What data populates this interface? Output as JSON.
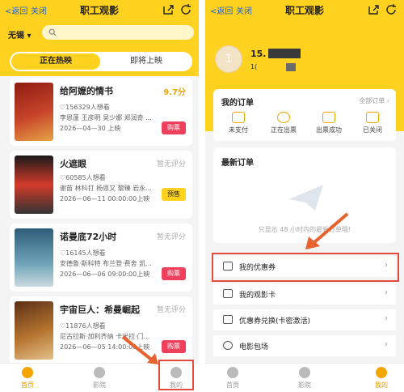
{
  "left": {
    "nav": {
      "back": "<返回",
      "close": "关闭",
      "title": "职工观影"
    },
    "city": "无锡 ▾",
    "tabs": {
      "now": "正在热映",
      "soon": "即将上映"
    },
    "movies": [
      {
        "title": "给阿嬷的情书",
        "score": "9.7分",
        "want": "♡156329人想看",
        "cast": "李恩蓬 王彦明 吴少娜 郑润奇 ...",
        "date": "2026—04—30 上映",
        "action": "购票",
        "poster_colors": [
          "#8d1c12",
          "#c8442a",
          "#e6a447"
        ]
      },
      {
        "title": "火遮眼",
        "score": "暂无评分",
        "want": "♡60585人想看",
        "cast": "谢苗 林科打 杨恩又 黎臻 岩永...",
        "date": "2026—06—11 00:00:00上映",
        "action": "预售",
        "poster_colors": [
          "#1a1a1a",
          "#d33a2a",
          "#eeeeee"
        ]
      },
      {
        "title": "诺曼底72小时",
        "score": "暂无评分",
        "want": "♡16145人想看",
        "cast": "安德鲁·斯科特 布兰登·费舍 凯...",
        "date": "2026—06—06 09:00:00上映",
        "action": "购票",
        "poster_colors": [
          "#2e5d79",
          "#6fa3b8",
          "#c9d9e0"
        ]
      },
      {
        "title": "宇宙巨人：希曼崛起",
        "score": "暂无评分",
        "want": "♡11876人想看",
        "cast": "尼古拉斯·加利齐纳 卡米拉·门...",
        "date": "2026—06—05 14:00:00上映",
        "action": "购票",
        "poster_colors": [
          "#5b2f16",
          "#b4742f",
          "#e3c089"
        ]
      }
    ],
    "tabbar": {
      "home": "首页",
      "cinema": "影院",
      "mine": "我的"
    }
  },
  "right": {
    "nav": {
      "back": "<返回",
      "close": "关闭",
      "title": "职工观影"
    },
    "avatar_initial": "1",
    "user": {
      "name_prefix": "15.",
      "line2": "1("
    },
    "orders": {
      "title": "我的订单",
      "all": "全部订单 ›",
      "statuses": [
        "未支付",
        "正在出票",
        "出票成功",
        "已关闭"
      ]
    },
    "latest": {
      "title": "最新订单",
      "empty": "只显示 48 小时内的最新订单哦!"
    },
    "menu": [
      "我的优惠券",
      "我的观影卡",
      "优惠券兑换(卡密激活)",
      "电影包场"
    ],
    "tabbar": {
      "home": "首页",
      "cinema": "影院",
      "mine": "我的"
    }
  },
  "colors": {
    "brand": "#ffd21f",
    "buy": "#ee3f5c",
    "highlight": "#e34b3c"
  }
}
